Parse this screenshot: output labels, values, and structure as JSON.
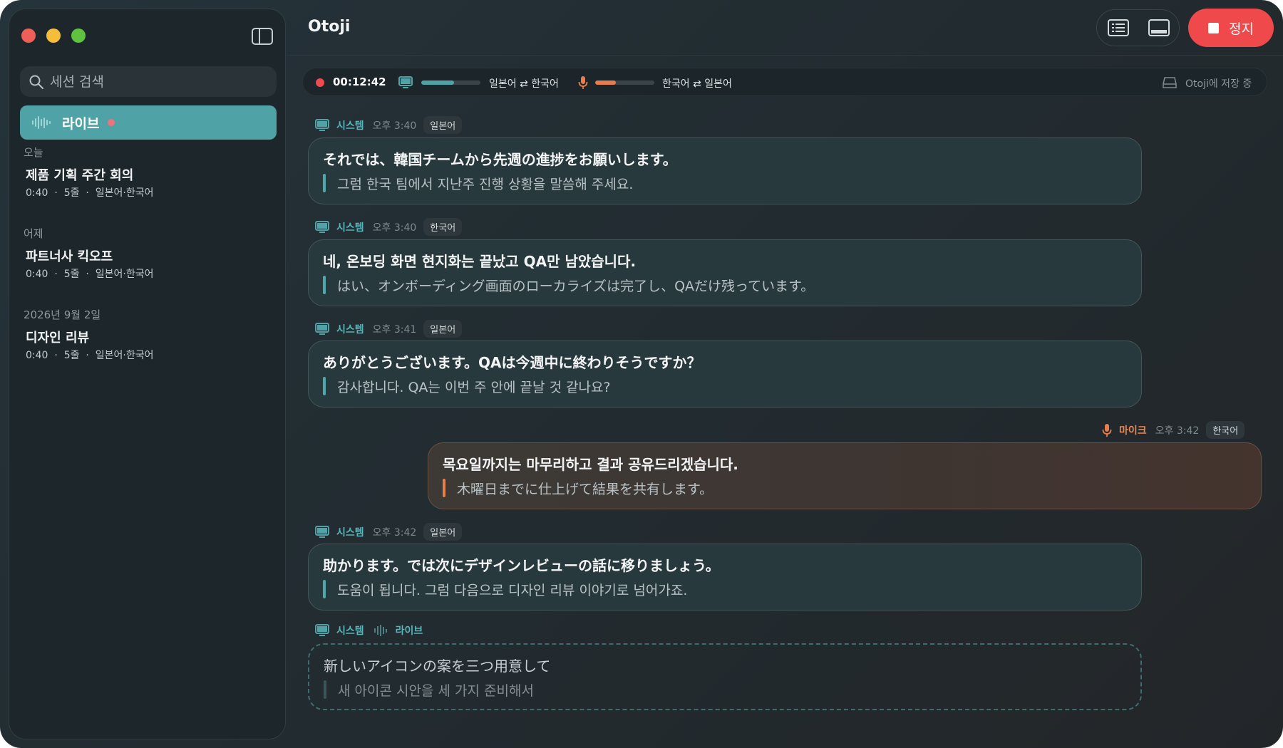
{
  "app": {
    "title": "Otoji"
  },
  "sidebar": {
    "search_placeholder": "세션 검색",
    "live_label": "라이브",
    "groups": [
      {
        "label": "오늘",
        "sessions": [
          {
            "title": "제품 기획 주간 회의",
            "meta": "0:40  ·  5줄  ·  일본어·한국어"
          }
        ]
      },
      {
        "label": "어제",
        "sessions": [
          {
            "title": "파트너사 킥오프",
            "meta": "0:40  ·  5줄  ·  일본어·한국어"
          }
        ]
      },
      {
        "label": "2026년 9월 2일",
        "sessions": [
          {
            "title": "디자인 리뷰",
            "meta": "0:40  ·  5줄  ·  일본어·한국어"
          }
        ]
      }
    ]
  },
  "toolbar": {
    "stop_label": "정지"
  },
  "status": {
    "timer": "00:12:42",
    "system_pair": "일본어 ⇄ 한국어",
    "system_level": 0.55,
    "mic_pair": "한국어 ⇄ 일본어",
    "mic_level": 0.35,
    "save_text": "Otoji에 저장 중"
  },
  "colors": {
    "accent": "#4fa2a6",
    "mic": "#e57e4c",
    "stop": "#f0494b"
  },
  "messages": [
    {
      "source": "시스템",
      "time": "오후 3:40",
      "lang": "일본어",
      "original": "それでは、韓国チームから先週の進捗をお願いします。",
      "translation": "그럼 한국 팀에서 지난주 진행 상황을 말씀해 주세요."
    },
    {
      "source": "시스템",
      "time": "오후 3:40",
      "lang": "한국어",
      "original": "네, 온보딩 화면 현지화는 끝났고 QA만 남았습니다.",
      "translation": "はい、オンボーディング画面のローカライズは完了し、QAだけ残っています。"
    },
    {
      "source": "시스템",
      "time": "오후 3:41",
      "lang": "일본어",
      "original": "ありがとうございます。QAは今週中に終わりそうですか？",
      "translation": "감사합니다. QA는 이번 주 안에 끝날 것 같나요?"
    },
    {
      "source": "마이크",
      "time": "오후 3:42",
      "lang": "한국어",
      "original": "목요일까지는 마무리하고 결과 공유드리겠습니다.",
      "translation": "木曜日までに仕上げて結果を共有します。"
    },
    {
      "source": "시스템",
      "time": "오후 3:42",
      "lang": "일본어",
      "original": "助かります。では次にデザインレビューの話に移りましょう。",
      "translation": "도움이 됩니다. 그럼 다음으로 디자인 리뷰 이야기로 넘어가죠."
    },
    {
      "source": "시스템",
      "live_label": "라이브",
      "original": "新しいアイコンの案を三つ用意して",
      "translation": "새 아이콘 시안을 세 가지 준비해서"
    }
  ]
}
